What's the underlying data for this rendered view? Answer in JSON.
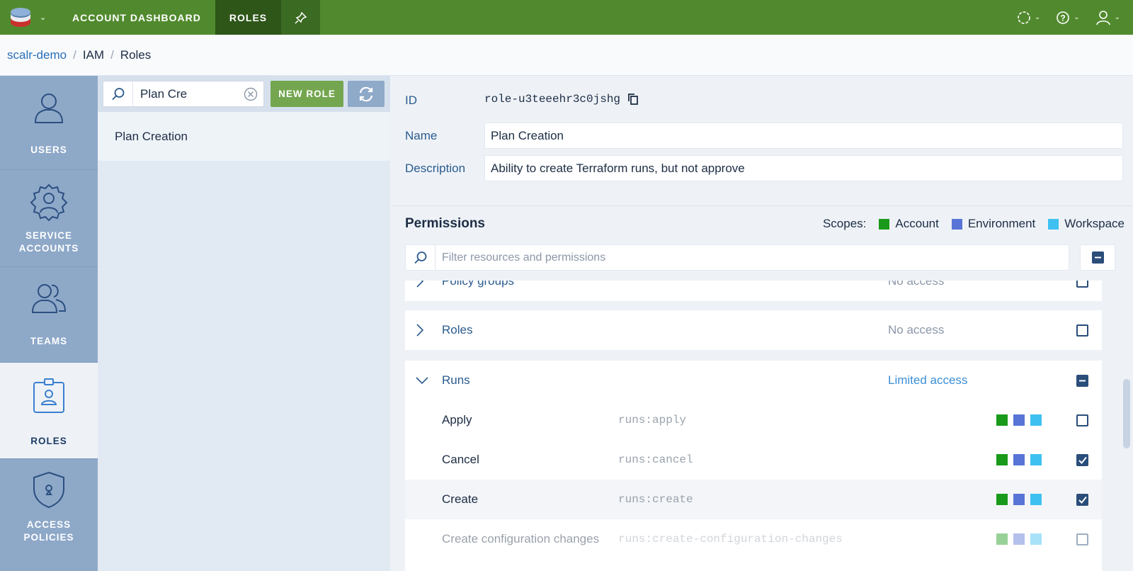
{
  "topbar": {
    "nav": [
      "ACCOUNT DASHBOARD",
      "ROLES"
    ],
    "colors": {
      "bar": "#518a2e",
      "active": "#2e5619"
    }
  },
  "breadcrumb": [
    "scalr-demo",
    "IAM",
    "Roles"
  ],
  "sidebar": {
    "items": [
      {
        "label_lines": [
          "USERS"
        ],
        "icon": "user-icon"
      },
      {
        "label_lines": [
          "SERVICE",
          "ACCOUNTS"
        ],
        "icon": "service-account-icon"
      },
      {
        "label_lines": [
          "TEAMS"
        ],
        "icon": "teams-icon"
      },
      {
        "label_lines": [
          "ROLES"
        ],
        "icon": "role-badge-icon",
        "active": true
      },
      {
        "label_lines": [
          "ACCESS",
          "POLICIES"
        ],
        "icon": "shield-icon"
      }
    ]
  },
  "roles_list": {
    "search_value": "Plan Cre",
    "new_role_label": "NEW ROLE",
    "items": [
      "Plan Creation"
    ]
  },
  "details": {
    "id_label": "ID",
    "id_value": "role-u3teeehr3c0jshg",
    "name_label": "Name",
    "name_value": "Plan Creation",
    "description_label": "Description",
    "description_value": "Ability to create Terraform runs, but not approve"
  },
  "permissions": {
    "title": "Permissions",
    "scopes_label": "Scopes:",
    "scopes": [
      {
        "name": "Account",
        "color": "#1a9a1a"
      },
      {
        "name": "Environment",
        "color": "#5874d6"
      },
      {
        "name": "Workspace",
        "color": "#3ec1f1"
      }
    ],
    "filter_placeholder": "Filter resources and permissions",
    "resources": [
      {
        "name": "Policy groups",
        "access": "No access"
      },
      {
        "name": "Roles",
        "access": "No access"
      },
      {
        "name": "Runs",
        "access": "Limited access"
      }
    ],
    "run_permissions": [
      {
        "name": "Apply",
        "code": "runs:apply",
        "checked": false
      },
      {
        "name": "Cancel",
        "code": "runs:cancel",
        "checked": true
      },
      {
        "name": "Create",
        "code": "runs:create",
        "checked": true
      },
      {
        "name": "Create configuration changes",
        "code": "runs:create-configuration-changes",
        "checked": false
      }
    ]
  }
}
